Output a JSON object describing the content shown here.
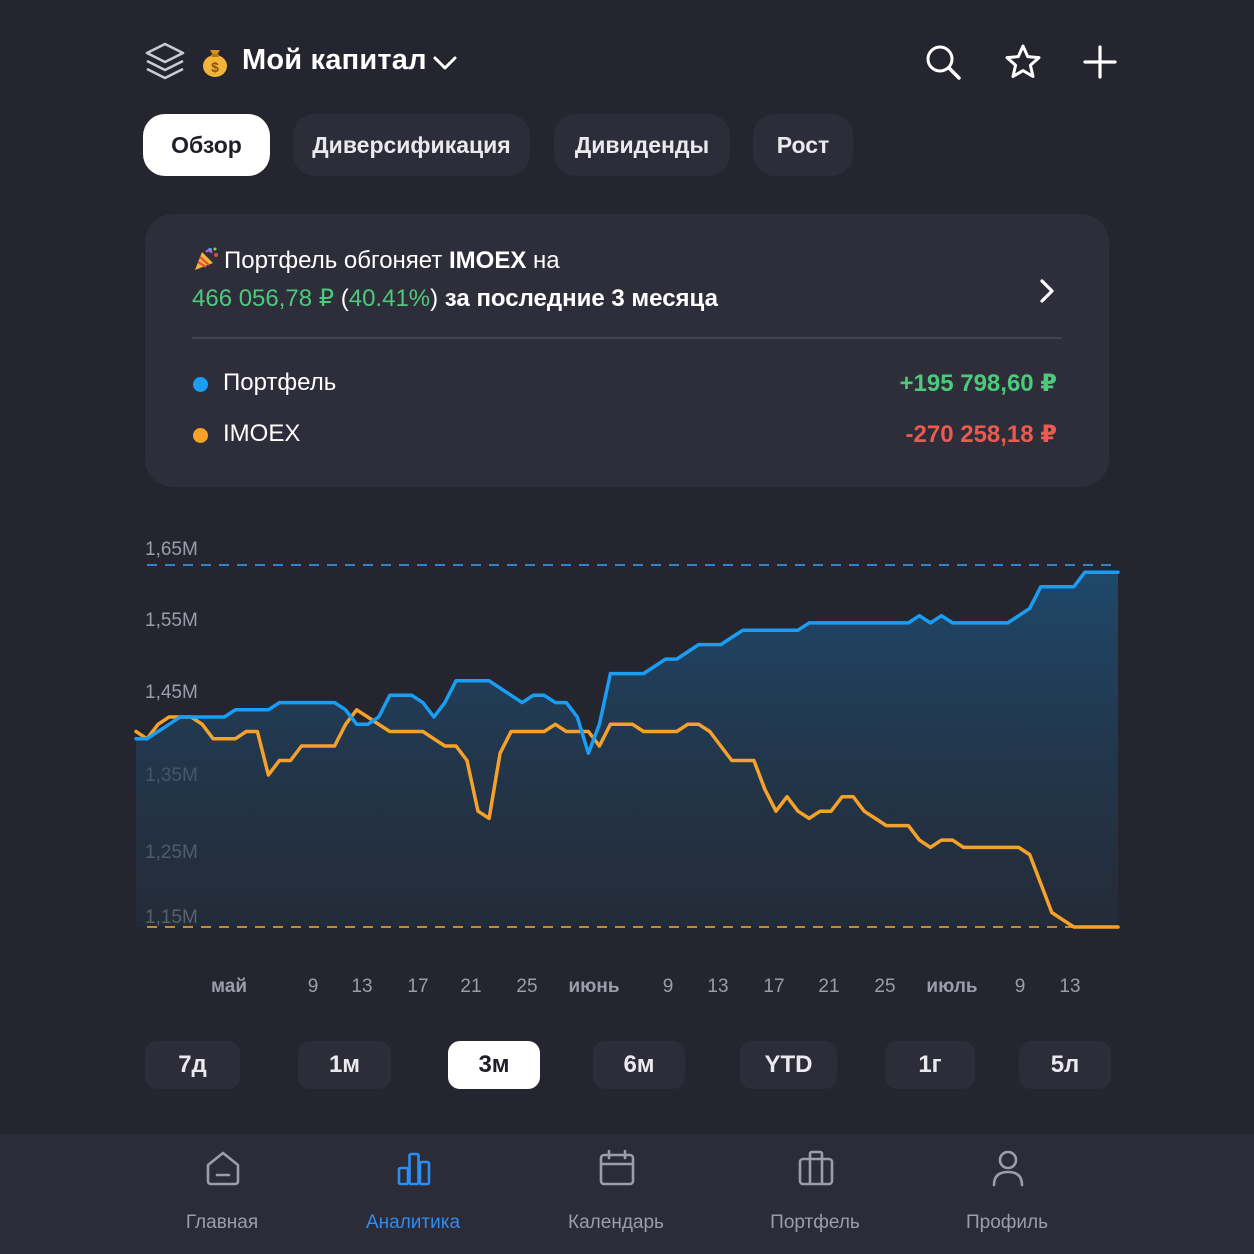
{
  "header": {
    "title": "Мой капитал",
    "icons": [
      "layers-icon",
      "money-bag-icon",
      "chevron-down-icon",
      "search-icon",
      "star-icon",
      "plus-icon"
    ]
  },
  "tabs": [
    {
      "label": "Обзор",
      "active": true
    },
    {
      "label": "Диверсификация",
      "active": false
    },
    {
      "label": "Дивиденды",
      "active": false
    },
    {
      "label": "Рост",
      "active": false
    }
  ],
  "summary": {
    "line1_prefix": "Портфель обгоняет ",
    "line1_index": "IMOEX",
    "line1_suffix": " на",
    "amount": "466 056,78 ₽",
    "percent_open": "(",
    "percent": "40.41%",
    "percent_close": ")",
    "period_text": " за последние 3 месяца",
    "legend": [
      {
        "name": "Портфель",
        "value": "+195 798,60 ₽",
        "color": "#1a9df2",
        "value_color": "#4cc97a"
      },
      {
        "name": "IMOEX",
        "value": "-270 258,18 ₽",
        "color": "#f5a12a",
        "value_color": "#ea5a4f"
      }
    ]
  },
  "chart_data": {
    "type": "line",
    "y_ticks": [
      "1,65M",
      "1,55M",
      "1,45M",
      "1,35M",
      "1,25M",
      "1,15M"
    ],
    "ylim": [
      1.15,
      1.65
    ],
    "x_ticks": [
      "май",
      "9",
      "13",
      "17",
      "21",
      "25",
      "июнь",
      "9",
      "13",
      "17",
      "21",
      "25",
      "июль",
      "9",
      "13"
    ],
    "series": [
      {
        "name": "Портфель",
        "color": "#1a9df2",
        "values": [
          1.41,
          1.41,
          1.42,
          1.43,
          1.44,
          1.44,
          1.44,
          1.44,
          1.44,
          1.45,
          1.45,
          1.45,
          1.45,
          1.46,
          1.46,
          1.46,
          1.46,
          1.46,
          1.46,
          1.45,
          1.43,
          1.43,
          1.44,
          1.47,
          1.47,
          1.47,
          1.46,
          1.44,
          1.46,
          1.49,
          1.49,
          1.49,
          1.49,
          1.48,
          1.47,
          1.46,
          1.47,
          1.47,
          1.46,
          1.46,
          1.44,
          1.39,
          1.43,
          1.5,
          1.5,
          1.5,
          1.5,
          1.51,
          1.52,
          1.52,
          1.53,
          1.54,
          1.54,
          1.54,
          1.55,
          1.56,
          1.56,
          1.56,
          1.56,
          1.56,
          1.56,
          1.57,
          1.57,
          1.57,
          1.57,
          1.57,
          1.57,
          1.57,
          1.57,
          1.57,
          1.57,
          1.58,
          1.57,
          1.58,
          1.57,
          1.57,
          1.57,
          1.57,
          1.57,
          1.57,
          1.58,
          1.59,
          1.62,
          1.62,
          1.62,
          1.62,
          1.64,
          1.64,
          1.64,
          1.64
        ]
      },
      {
        "name": "IMOEX",
        "color": "#f5a12a",
        "values": [
          1.42,
          1.41,
          1.43,
          1.44,
          1.44,
          1.44,
          1.43,
          1.41,
          1.41,
          1.41,
          1.42,
          1.42,
          1.36,
          1.38,
          1.38,
          1.4,
          1.4,
          1.4,
          1.4,
          1.43,
          1.45,
          1.44,
          1.43,
          1.42,
          1.42,
          1.42,
          1.42,
          1.41,
          1.4,
          1.4,
          1.38,
          1.31,
          1.3,
          1.39,
          1.42,
          1.42,
          1.42,
          1.42,
          1.43,
          1.42,
          1.42,
          1.42,
          1.4,
          1.43,
          1.43,
          1.43,
          1.42,
          1.42,
          1.42,
          1.42,
          1.43,
          1.43,
          1.42,
          1.4,
          1.38,
          1.38,
          1.38,
          1.34,
          1.31,
          1.33,
          1.31,
          1.3,
          1.31,
          1.31,
          1.33,
          1.33,
          1.31,
          1.3,
          1.29,
          1.29,
          1.29,
          1.27,
          1.26,
          1.27,
          1.27,
          1.26,
          1.26,
          1.26,
          1.26,
          1.26,
          1.26,
          1.25,
          1.21,
          1.17,
          1.16,
          1.15,
          1.15,
          1.15,
          1.15,
          1.15
        ]
      }
    ],
    "grid": false
  },
  "periods": [
    {
      "label": "7д",
      "active": false
    },
    {
      "label": "1м",
      "active": false
    },
    {
      "label": "3м",
      "active": true
    },
    {
      "label": "6м",
      "active": false
    },
    {
      "label": "YTD",
      "active": false
    },
    {
      "label": "1г",
      "active": false
    },
    {
      "label": "5л",
      "active": false
    }
  ],
  "bottom_nav": [
    {
      "label": "Главная",
      "icon": "home-icon",
      "active": false
    },
    {
      "label": "Аналитика",
      "icon": "bar-chart-icon",
      "active": true
    },
    {
      "label": "Календарь",
      "icon": "calendar-icon",
      "active": false
    },
    {
      "label": "Портфель",
      "icon": "briefcase-icon",
      "active": false
    },
    {
      "label": "Профиль",
      "icon": "user-icon",
      "active": false
    }
  ],
  "colors": {
    "background": "#24252f",
    "card": "#2d2e3a",
    "accent": "#2e8df0",
    "positive": "#4cc97a",
    "negative": "#ea5a4f"
  }
}
